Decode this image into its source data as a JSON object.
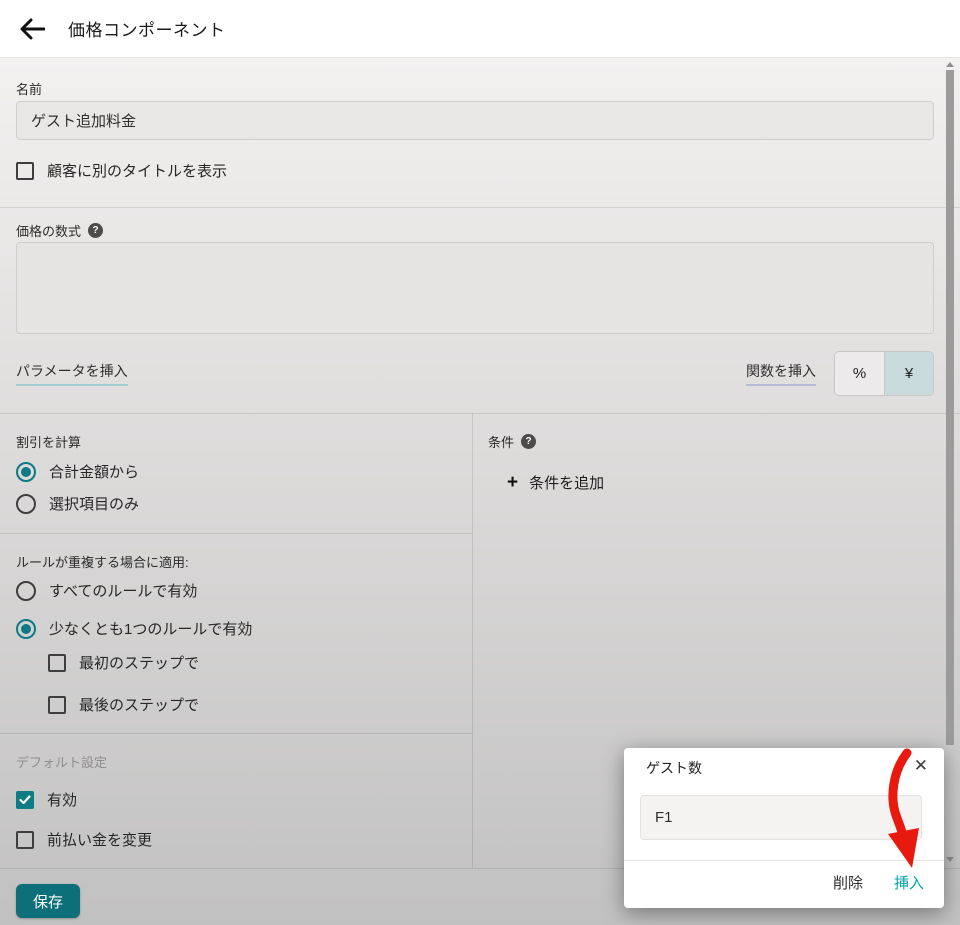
{
  "header": {
    "title": "価格コンポーネント"
  },
  "form": {
    "name_label": "名前",
    "name_value": "ゲスト追加料金",
    "customer_title_label": "顧客に別のタイトルを表示",
    "formula_label": "価格の数式",
    "formula_value": "",
    "insert_parameter_label": "パラメータを挿入",
    "insert_function_label": "関数を挿入",
    "unit_percent": "%",
    "unit_yen": "¥",
    "unit_selected": "¥"
  },
  "icons": {
    "help": "?",
    "plus": "+",
    "close": "✕"
  },
  "discount": {
    "title": "割引を計算",
    "options": [
      {
        "label": "合計金額から",
        "selected": true
      },
      {
        "label": "選択項目のみ",
        "selected": false
      }
    ]
  },
  "overlap": {
    "title": "ルールが重複する場合に適用:",
    "options": [
      {
        "label": "すべてのルールで有効",
        "selected": false
      },
      {
        "label": "少なくとも1つのルールで有効",
        "selected": true
      }
    ],
    "step_checkboxes": [
      {
        "label": "最初のステップで",
        "checked": false
      },
      {
        "label": "最後のステップで",
        "checked": false
      }
    ]
  },
  "defaults": {
    "title": "デフォルト設定",
    "enabled": {
      "label": "有効",
      "checked": true
    },
    "prepayment": {
      "label": "前払い金を変更",
      "checked": false
    }
  },
  "conditions": {
    "title": "条件",
    "add_label": "条件を追加"
  },
  "footer": {
    "save_label": "保存"
  },
  "dialog": {
    "title": "ゲスト数",
    "input_value": "F1",
    "delete_label": "削除",
    "insert_label": "挿入"
  },
  "colors": {
    "teal": "#0c7a85",
    "save_button": "#0d6f79",
    "insert_link": "#00a2ac",
    "selected_toggle_bg": "#c9dadc",
    "annotation_red": "#e8190f"
  }
}
